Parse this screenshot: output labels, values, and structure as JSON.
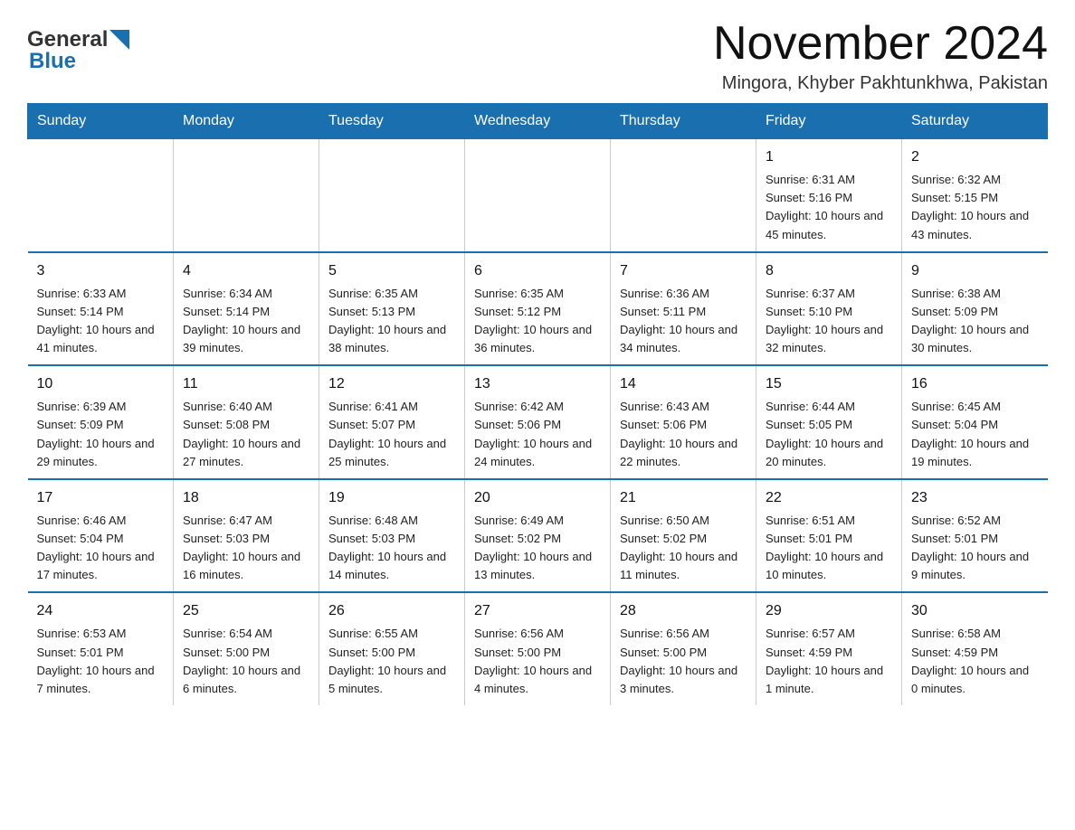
{
  "header": {
    "logo_general": "General",
    "logo_blue": "Blue",
    "month_title": "November 2024",
    "location": "Mingora, Khyber Pakhtunkhwa, Pakistan"
  },
  "weekdays": [
    "Sunday",
    "Monday",
    "Tuesday",
    "Wednesday",
    "Thursday",
    "Friday",
    "Saturday"
  ],
  "weeks": [
    [
      {
        "day": "",
        "info": ""
      },
      {
        "day": "",
        "info": ""
      },
      {
        "day": "",
        "info": ""
      },
      {
        "day": "",
        "info": ""
      },
      {
        "day": "",
        "info": ""
      },
      {
        "day": "1",
        "info": "Sunrise: 6:31 AM\nSunset: 5:16 PM\nDaylight: 10 hours and 45 minutes."
      },
      {
        "day": "2",
        "info": "Sunrise: 6:32 AM\nSunset: 5:15 PM\nDaylight: 10 hours and 43 minutes."
      }
    ],
    [
      {
        "day": "3",
        "info": "Sunrise: 6:33 AM\nSunset: 5:14 PM\nDaylight: 10 hours and 41 minutes."
      },
      {
        "day": "4",
        "info": "Sunrise: 6:34 AM\nSunset: 5:14 PM\nDaylight: 10 hours and 39 minutes."
      },
      {
        "day": "5",
        "info": "Sunrise: 6:35 AM\nSunset: 5:13 PM\nDaylight: 10 hours and 38 minutes."
      },
      {
        "day": "6",
        "info": "Sunrise: 6:35 AM\nSunset: 5:12 PM\nDaylight: 10 hours and 36 minutes."
      },
      {
        "day": "7",
        "info": "Sunrise: 6:36 AM\nSunset: 5:11 PM\nDaylight: 10 hours and 34 minutes."
      },
      {
        "day": "8",
        "info": "Sunrise: 6:37 AM\nSunset: 5:10 PM\nDaylight: 10 hours and 32 minutes."
      },
      {
        "day": "9",
        "info": "Sunrise: 6:38 AM\nSunset: 5:09 PM\nDaylight: 10 hours and 30 minutes."
      }
    ],
    [
      {
        "day": "10",
        "info": "Sunrise: 6:39 AM\nSunset: 5:09 PM\nDaylight: 10 hours and 29 minutes."
      },
      {
        "day": "11",
        "info": "Sunrise: 6:40 AM\nSunset: 5:08 PM\nDaylight: 10 hours and 27 minutes."
      },
      {
        "day": "12",
        "info": "Sunrise: 6:41 AM\nSunset: 5:07 PM\nDaylight: 10 hours and 25 minutes."
      },
      {
        "day": "13",
        "info": "Sunrise: 6:42 AM\nSunset: 5:06 PM\nDaylight: 10 hours and 24 minutes."
      },
      {
        "day": "14",
        "info": "Sunrise: 6:43 AM\nSunset: 5:06 PM\nDaylight: 10 hours and 22 minutes."
      },
      {
        "day": "15",
        "info": "Sunrise: 6:44 AM\nSunset: 5:05 PM\nDaylight: 10 hours and 20 minutes."
      },
      {
        "day": "16",
        "info": "Sunrise: 6:45 AM\nSunset: 5:04 PM\nDaylight: 10 hours and 19 minutes."
      }
    ],
    [
      {
        "day": "17",
        "info": "Sunrise: 6:46 AM\nSunset: 5:04 PM\nDaylight: 10 hours and 17 minutes."
      },
      {
        "day": "18",
        "info": "Sunrise: 6:47 AM\nSunset: 5:03 PM\nDaylight: 10 hours and 16 minutes."
      },
      {
        "day": "19",
        "info": "Sunrise: 6:48 AM\nSunset: 5:03 PM\nDaylight: 10 hours and 14 minutes."
      },
      {
        "day": "20",
        "info": "Sunrise: 6:49 AM\nSunset: 5:02 PM\nDaylight: 10 hours and 13 minutes."
      },
      {
        "day": "21",
        "info": "Sunrise: 6:50 AM\nSunset: 5:02 PM\nDaylight: 10 hours and 11 minutes."
      },
      {
        "day": "22",
        "info": "Sunrise: 6:51 AM\nSunset: 5:01 PM\nDaylight: 10 hours and 10 minutes."
      },
      {
        "day": "23",
        "info": "Sunrise: 6:52 AM\nSunset: 5:01 PM\nDaylight: 10 hours and 9 minutes."
      }
    ],
    [
      {
        "day": "24",
        "info": "Sunrise: 6:53 AM\nSunset: 5:01 PM\nDaylight: 10 hours and 7 minutes."
      },
      {
        "day": "25",
        "info": "Sunrise: 6:54 AM\nSunset: 5:00 PM\nDaylight: 10 hours and 6 minutes."
      },
      {
        "day": "26",
        "info": "Sunrise: 6:55 AM\nSunset: 5:00 PM\nDaylight: 10 hours and 5 minutes."
      },
      {
        "day": "27",
        "info": "Sunrise: 6:56 AM\nSunset: 5:00 PM\nDaylight: 10 hours and 4 minutes."
      },
      {
        "day": "28",
        "info": "Sunrise: 6:56 AM\nSunset: 5:00 PM\nDaylight: 10 hours and 3 minutes."
      },
      {
        "day": "29",
        "info": "Sunrise: 6:57 AM\nSunset: 4:59 PM\nDaylight: 10 hours and 1 minute."
      },
      {
        "day": "30",
        "info": "Sunrise: 6:58 AM\nSunset: 4:59 PM\nDaylight: 10 hours and 0 minutes."
      }
    ]
  ]
}
